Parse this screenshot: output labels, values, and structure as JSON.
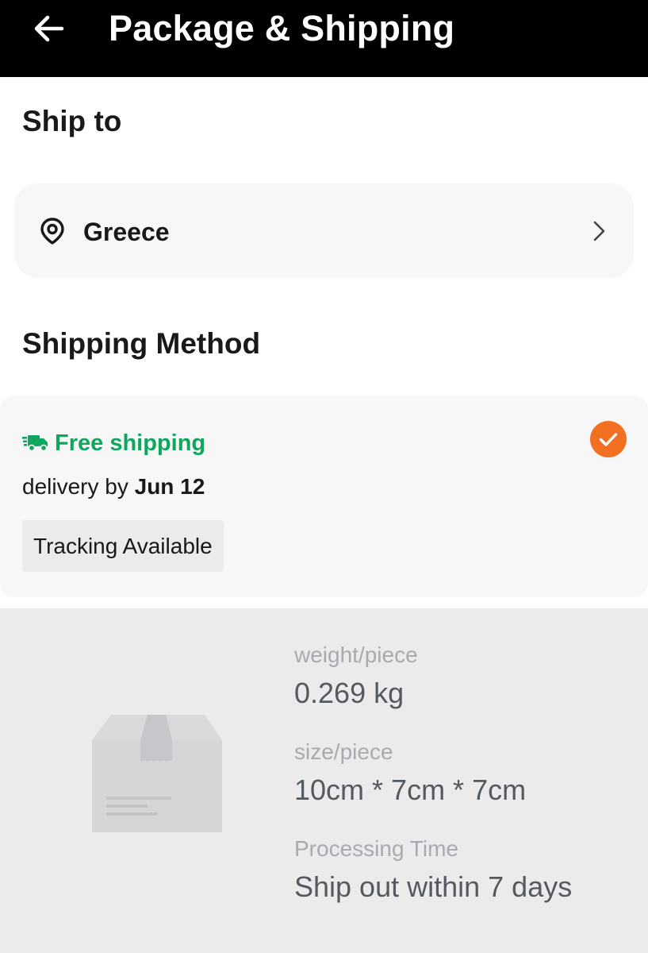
{
  "header": {
    "back_icon": "arrow-left-icon",
    "title": "Package & Shipping"
  },
  "ship_to": {
    "title": "Ship to",
    "location_icon": "location-pin-icon",
    "country": "Greece",
    "chevron_icon": "chevron-right-icon"
  },
  "shipping_method": {
    "title": "Shipping Method",
    "option": {
      "icon": "truck-icon",
      "label": "Free shipping",
      "delivery_prefix": "delivery by",
      "delivery_date": "Jun 12",
      "badge": "Tracking Available",
      "selected": true,
      "selected_icon": "check-circle-icon"
    }
  },
  "package_info": {
    "illustration": "package-box-icon",
    "weight_label": "weight/piece",
    "weight_value": "0.269 kg",
    "size_label": "size/piece",
    "size_value": "10cm * 7cm * 7cm",
    "processing_label": "Processing Time",
    "processing_value": "Ship out within 7 days"
  },
  "colors": {
    "header_bg": "#000000",
    "free_shipping_green": "#11a65e",
    "selected_orange": "#f36f21",
    "card_bg": "#f7f7f7",
    "info_panel_bg": "#ebebeb"
  }
}
